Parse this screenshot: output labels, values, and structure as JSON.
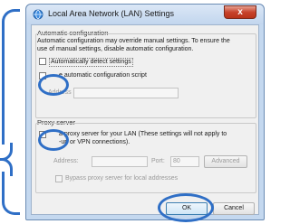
{
  "window": {
    "title": "Local Area Network (LAN) Settings",
    "close_label": "x"
  },
  "automatic_configuration": {
    "group_label": "Automatic configuration",
    "description": [
      "Automatic configuration may override manual settings. To ensure the",
      "use of manual settings, disable automatic configuration."
    ],
    "detect_settings_label": "Automatically detect settings",
    "detect_settings_checked": false,
    "script_label": "Use automatic configuration script",
    "script_label_visible": "e automatic configuration script",
    "script_checked": false,
    "address_label": "Address",
    "address_value": ""
  },
  "proxy_server": {
    "group_label": "Proxy server",
    "use_proxy_label_line1_visible": "a proxy server for your LAN (These settings will not apply to",
    "use_proxy_label_line2_visible": "-up or VPN connections).",
    "use_proxy_checked": false,
    "address_label": "Address:",
    "address_value": "",
    "port_label": "Port:",
    "port_value": "80",
    "advanced_label": "Advanced",
    "bypass_label": "Bypass proxy server for local addresses",
    "bypass_checked": false
  },
  "buttons": {
    "ok_label": "OK",
    "cancel_label": "Cancel"
  },
  "annotations": {
    "highlight_color": "#2f6fc6"
  }
}
